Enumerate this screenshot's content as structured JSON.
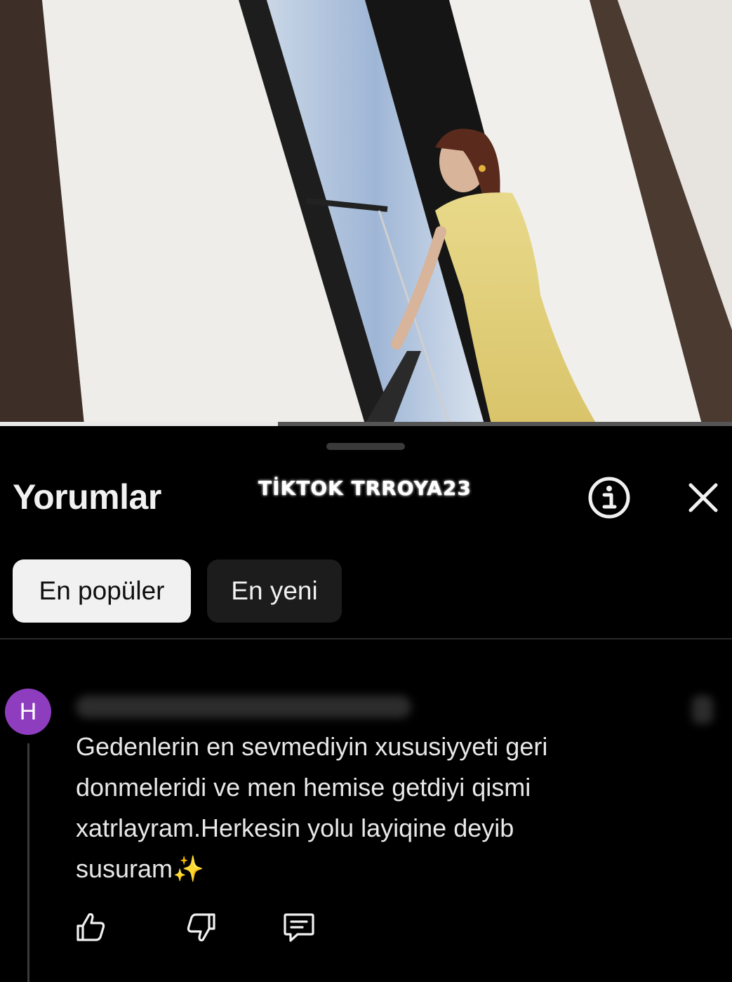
{
  "video": {
    "progress_fraction": 0.38
  },
  "comments_panel": {
    "title": "Yorumlar",
    "watermark": "TİKTOK TRROYA23",
    "info_icon": "info-icon",
    "close_icon": "close-icon",
    "sort_chips": [
      {
        "label": "En popüler",
        "selected": true
      },
      {
        "label": "En yeni",
        "selected": false
      }
    ]
  },
  "comment": {
    "avatar_letter": "H",
    "avatar_color": "#8e3dbf",
    "text": "Gedenlerin en sevmediyin xususiyyeti geri donmeleridi ve men hemise getdiyi qismi xatrlayram.Herkesin yolu layiqine deyib susuram",
    "emoji": "✨",
    "actions": {
      "like_icon": "thumbs-up-icon",
      "dislike_icon": "thumbs-down-icon",
      "reply_icon": "reply-icon"
    }
  }
}
